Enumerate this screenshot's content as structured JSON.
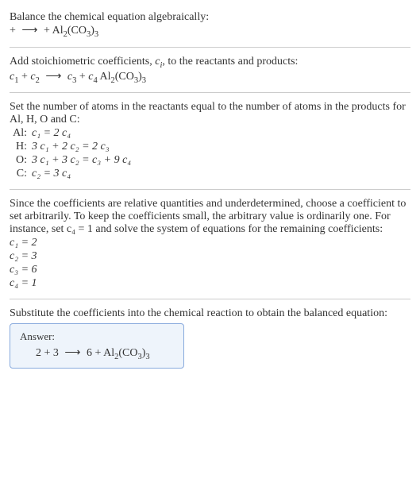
{
  "intro": {
    "line1": "Balance the chemical equation algebraically:",
    "reaction_prefix": " + ",
    "arrow": "⟶",
    "reaction_mid": " + ",
    "product": "Al",
    "product_sub1": "2",
    "product_paren": "(CO",
    "product_sub2": "3",
    "product_close": ")",
    "product_sub3": "3"
  },
  "step1": {
    "text_a": "Add stoichiometric coefficients, ",
    "ci_c": "c",
    "ci_i": "i",
    "text_b": ", to the reactants and products:",
    "c1": "c",
    "c1s": "1",
    "plus1": " + ",
    "c2": "c",
    "c2s": "2",
    "arrow": "⟶",
    "c3": "c",
    "c3s": "3",
    "plus2": " + ",
    "c4": "c",
    "c4s": "4",
    "product": " Al",
    "psub1": "2",
    "pparen": "(CO",
    "psub2": "3",
    "pclose": ")",
    "psub3": "3"
  },
  "step2": {
    "intro": "Set the number of atoms in the reactants equal to the number of atoms in the products for Al, H, O and C:",
    "rows": [
      {
        "label": "Al:",
        "eq": "c₁ = 2 c₄"
      },
      {
        "label": "H:",
        "eq": "3 c₁ + 2 c₂ = 2 c₃"
      },
      {
        "label": "O:",
        "eq": "3 c₁ + 3 c₂ = c₃ + 9 c₄"
      },
      {
        "label": "C:",
        "eq": "c₂ = 3 c₄"
      }
    ]
  },
  "step3": {
    "intro": "Since the coefficients are relative quantities and underdetermined, choose a coefficient to set arbitrarily. To keep the coefficients small, the arbitrary value is ordinarily one. For instance, set c₄ = 1 and solve the system of equations for the remaining coefficients:",
    "coefs": [
      "c₁ = 2",
      "c₂ = 3",
      "c₃ = 6",
      "c₄ = 1"
    ]
  },
  "step4": {
    "intro": "Substitute the coefficients into the chemical reaction to obtain the balanced equation:"
  },
  "answer": {
    "label": "Answer:",
    "n1": "2",
    "plus1": " + ",
    "n2": "3",
    "arrow": "⟶",
    "n3": "6",
    "plus2": " + ",
    "product": "Al",
    "psub1": "2",
    "pparen": "(CO",
    "psub2": "3",
    "pclose": ")",
    "psub3": "3"
  },
  "chart_data": {
    "type": "table",
    "title": "Balancing chemical equation for Al2(CO3)3 formation",
    "atom_balance": [
      {
        "element": "Al",
        "equation": "c1 = 2 c4"
      },
      {
        "element": "H",
        "equation": "3 c1 + 2 c2 = 2 c3"
      },
      {
        "element": "O",
        "equation": "3 c1 + 3 c2 = c3 + 9 c4"
      },
      {
        "element": "C",
        "equation": "c2 = 3 c4"
      }
    ],
    "solution": {
      "c1": 2,
      "c2": 3,
      "c3": 6,
      "c4": 1
    },
    "balanced_equation": "2 + 3 ⟶ 6 + Al2(CO3)3"
  }
}
